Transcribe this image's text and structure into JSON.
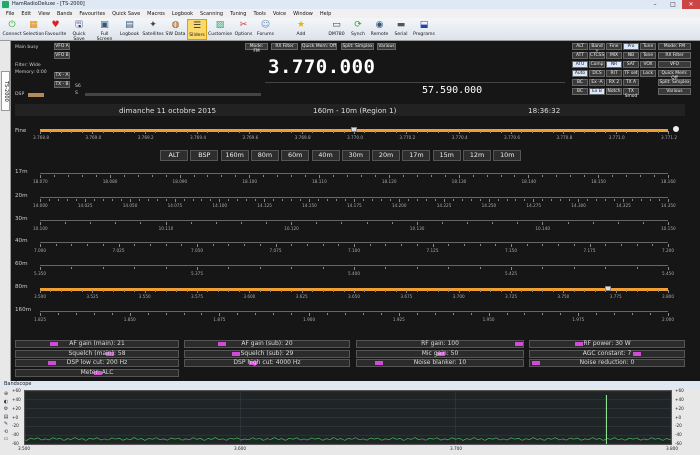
{
  "window": {
    "title": "HamRadioDeluxe - [TS-2000]"
  },
  "menu": [
    "File",
    "Edit",
    "View",
    "Bands",
    "Favourites",
    "Quick Save",
    "Macros",
    "Logbook",
    "Scanning",
    "Tuning",
    "Tools",
    "Voice",
    "Window",
    "Help"
  ],
  "toolbar": [
    {
      "label": "Connect",
      "icon": "plug-icon",
      "glyph": "⏻",
      "color": "#2a2"
    },
    {
      "label": "Selection",
      "icon": "selection-icon",
      "glyph": "▦",
      "color": "#e58a00"
    },
    {
      "label": "Favourite",
      "icon": "favourite-icon",
      "glyph": "♥",
      "color": "#d22"
    },
    {
      "label": "Quick Save",
      "icon": "save-icon",
      "glyph": "🖫",
      "color": "#236"
    },
    {
      "label": "Full Screen",
      "icon": "fullscreen-icon",
      "glyph": "▣",
      "color": "#357"
    },
    {
      "label": "Logbook",
      "icon": "logbook-icon",
      "glyph": "▤",
      "color": "#357"
    },
    {
      "label": "Satellites",
      "icon": "satellite-icon",
      "glyph": "✦",
      "color": "#444"
    },
    {
      "label": "SW Data",
      "icon": "swdata-icon",
      "glyph": "◍",
      "color": "#a50"
    },
    {
      "label": "Sliders",
      "icon": "sliders-icon",
      "glyph": "☰",
      "color": "#333"
    },
    {
      "label": "Customise",
      "icon": "customise-icon",
      "glyph": "▨",
      "color": "#2a6"
    },
    {
      "label": "Options",
      "icon": "options-icon",
      "glyph": "✂",
      "color": "#c33"
    },
    {
      "label": "Forums",
      "icon": "forums-icon",
      "glyph": "☺",
      "color": "#58b"
    },
    {
      "label": "Add",
      "icon": "star-icon",
      "glyph": "★",
      "color": "#e8b400"
    },
    {
      "label": "DM780",
      "icon": "dm780-icon",
      "glyph": "▭",
      "color": "#333"
    },
    {
      "label": "Synch",
      "icon": "synch-icon",
      "glyph": "⟳",
      "color": "#2a2"
    },
    {
      "label": "Remote",
      "icon": "remote-icon",
      "glyph": "◉",
      "color": "#357"
    },
    {
      "label": "Serial",
      "icon": "serial-icon",
      "glyph": "▬",
      "color": "#555"
    },
    {
      "label": "Programs",
      "icon": "programs-icon",
      "glyph": "⬓",
      "color": "#24a"
    }
  ],
  "sidetab": "TS-2000",
  "status": {
    "main_busy": "Main busy",
    "filter": "Filter: Wide",
    "memory": "Memory: 0:00",
    "dsp": "DSP",
    "vfo_a": "VFO A",
    "vfo_b": "VFO B",
    "tx_a": "TX - A",
    "tx_b": "TX - B",
    "s_label": "S",
    "s_value": "S6"
  },
  "top_buttons": [
    "Mode: FM",
    "RX Filter",
    "Quick Mem: Off",
    "Split: Simplex",
    "Various"
  ],
  "freq_main": "3.770.000",
  "freq_sub": "57.590.000",
  "right_buttons": [
    [
      "ALT",
      "Band +",
      "Fine",
      "Pro",
      "Tune"
    ],
    [
      "ATT",
      "CTCSS",
      "MIX",
      "NB",
      "Tone"
    ],
    [
      "ATU",
      "Comp",
      "NR",
      "SAT",
      "VOX"
    ],
    [
      "Auto",
      "DCS",
      "RIT",
      "TF set",
      "Lock"
    ],
    [
      "BC",
      "Ex -A",
      "RX 2",
      "TX A",
      ""
    ],
    [
      "BC",
      "Ex B",
      "Notch",
      "TX Smod",
      ""
    ]
  ],
  "right_side_buttons": [
    "Mode: FM",
    "RX Filter",
    "VFO",
    "Quick Mem: Off",
    "Split: Simplex",
    "Various"
  ],
  "infobar": {
    "date": "dimanche 11 octobre 2015",
    "band": "160m - 10m (Region 1)",
    "time": "18:36:32"
  },
  "fine": {
    "label": "Fine",
    "ticks": [
      "3.768.8",
      "3.769.0",
      "3.769.2",
      "3.769.4",
      "3.769.6",
      "3.769.8",
      "3.770.0",
      "3.770.2",
      "3.770.4",
      "3.770.6",
      "3.770.8",
      "3.771.0",
      "3.771.2"
    ]
  },
  "band_buttons": [
    "ALT",
    "BSP",
    "160m",
    "80m",
    "60m",
    "40m",
    "30m",
    "20m",
    "17m",
    "15m",
    "12m",
    "10m"
  ],
  "bands": [
    {
      "label": "17m",
      "ticks": [
        "18.070",
        "18.080",
        "18.090",
        "18.100",
        "18.110",
        "18.120",
        "18.130",
        "18.140",
        "18.150",
        "18.160"
      ],
      "highlight": false
    },
    {
      "label": "20m",
      "ticks": [
        "14.000",
        "14.025",
        "14.050",
        "14.075",
        "14.100",
        "14.125",
        "14.150",
        "14.175",
        "14.200",
        "14.225",
        "14.250",
        "14.275",
        "14.300",
        "14.325",
        "14.350"
      ],
      "highlight": false
    },
    {
      "label": "30m",
      "ticks": [
        "10.100",
        "10.110",
        "10.120",
        "10.130",
        "10.140",
        "10.150"
      ],
      "highlight": false
    },
    {
      "label": "40m",
      "ticks": [
        "7.000",
        "7.025",
        "7.050",
        "7.075",
        "7.100",
        "7.125",
        "7.150",
        "7.175",
        "7.200"
      ],
      "highlight": false
    },
    {
      "label": "60m",
      "ticks": [
        "5.350",
        "5.375",
        "5.400",
        "5.425",
        "5.450"
      ],
      "highlight": false
    },
    {
      "label": "80m",
      "ticks": [
        "3.500",
        "3.525",
        "3.550",
        "3.575",
        "3.600",
        "3.625",
        "3.650",
        "3.675",
        "3.700",
        "3.725",
        "3.750",
        "3.775",
        "3.800"
      ],
      "highlight": true
    },
    {
      "label": "160m",
      "ticks": [
        "1.825",
        "1.850",
        "1.875",
        "1.900",
        "1.925",
        "1.950",
        "1.975",
        "2.000"
      ],
      "highlight": false
    }
  ],
  "controls": [
    [
      "AF gain (main): 21",
      "AF gain (sub): 20",
      "RF gain: 100",
      "RF power: 30 W"
    ],
    [
      "Squelch (main): 58",
      "Squelch (sub): 29",
      "Mic gain: 50",
      "AGC constant: 7"
    ],
    [
      "DSP low cut: 200 Hz",
      "DSP high cut: 4000 Hz",
      "Noise blanker: 10",
      "Noise reduction: 0"
    ],
    [
      "Meter: ALC",
      "",
      "",
      ""
    ]
  ],
  "control_levels": [
    [
      0.21,
      0.2,
      1.0,
      0.3
    ],
    [
      0.58,
      0.29,
      0.5,
      0.7
    ],
    [
      0.2,
      0.4,
      0.1,
      0.0
    ],
    [
      0.5,
      0,
      0,
      0
    ]
  ],
  "bandscope": {
    "title": "Bandscope",
    "yticks": [
      "+60",
      "+40",
      "+20",
      "+0",
      "-20",
      "-40",
      "-60"
    ],
    "xticks": [
      "3.500",
      "3.600",
      "3.700",
      "3.800"
    ],
    "peak_freq": 3.77
  },
  "colors": {
    "accent": "#f0a030",
    "knob": "#d14bd8",
    "freq": "#ffffff",
    "highlight_track": "#f0a030"
  }
}
